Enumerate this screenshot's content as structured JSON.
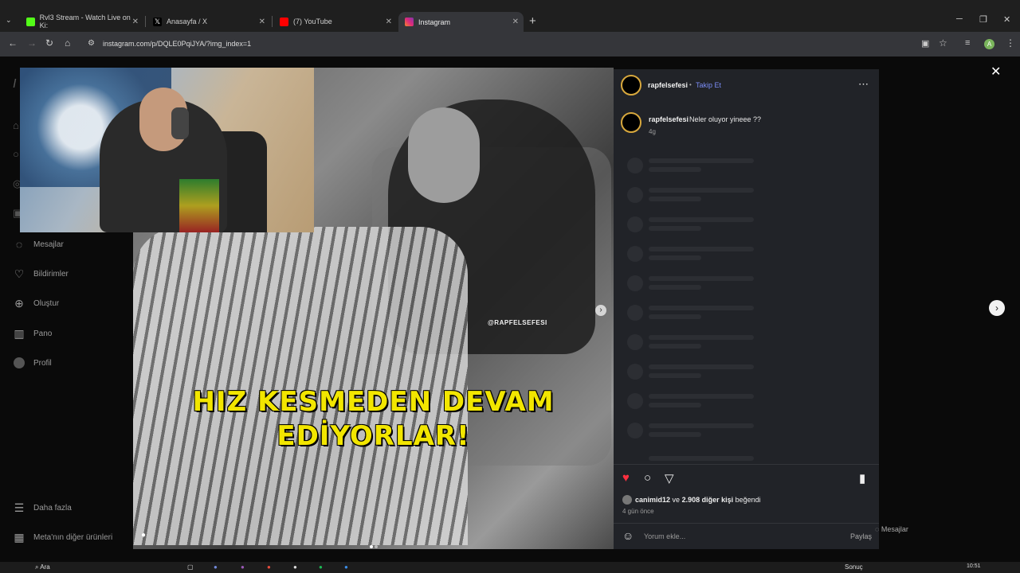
{
  "browser": {
    "tabs": [
      {
        "label": "Rvl3 Stream - Watch Live on Ki:",
        "favicon_color": "#53fc18"
      },
      {
        "label": "Anasayfa / X",
        "favicon_color": "#ffffff"
      },
      {
        "label": "(7) YouTube",
        "favicon_color": "#ff0000"
      },
      {
        "label": "Instagram",
        "favicon_color": "#e1306c"
      }
    ],
    "url": "instagram.com/p/DQLE0PqiJYA/?img_index=1",
    "profile_initial": "A"
  },
  "sidebar": {
    "items": [
      {
        "label": "Mesajlar",
        "icon": "messenger-icon"
      },
      {
        "label": "Bildirimler",
        "icon": "heart-icon"
      },
      {
        "label": "Oluştur",
        "icon": "plus-icon"
      },
      {
        "label": "Pano",
        "icon": "dashboard-icon"
      },
      {
        "label": "Profil",
        "icon": "avatar-icon"
      }
    ],
    "more_label": "Daha fazla",
    "meta_label": "Meta'nın diğer ürünleri"
  },
  "post": {
    "caption_line1": "HIZ KESMEDEN DEVAM",
    "caption_line2": "EDİYORLAR!",
    "watermark": "@RAPFELSEFESI"
  },
  "panel": {
    "username": "rapfelsefesi",
    "follow_label": "Takip Et",
    "comment_text": "Neler oluyor yineee ??",
    "comment_age": "4g",
    "liked_by_user": "canimid12",
    "liked_by_others": "2.908 diğer kişi",
    "liked_suffix": "beğendi",
    "liked_connector": "ve",
    "post_age": "4 gün önce",
    "comment_placeholder": "Yorum ekle...",
    "share_label": "Paylaş",
    "like_color": "#ff3040"
  },
  "messages_pill": "Mesajlar",
  "taskbar": {
    "search": "Ara",
    "time": "10:51",
    "tray_text": "Sonuç"
  }
}
